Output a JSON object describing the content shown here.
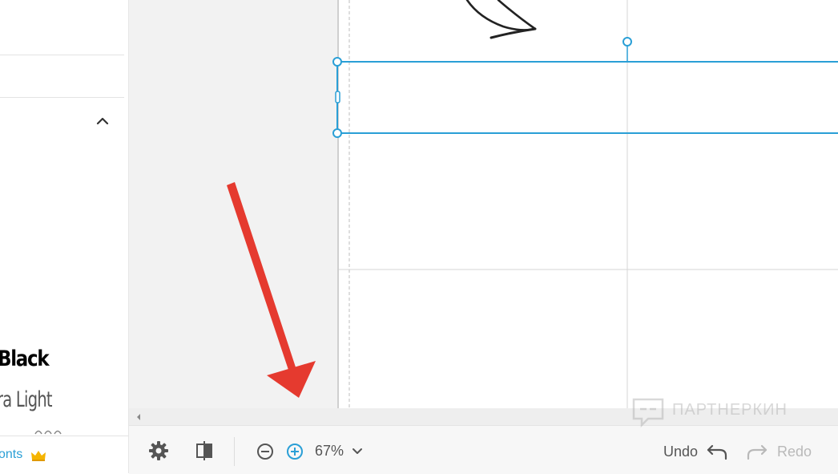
{
  "left_panel": {
    "font_samples": [
      {
        "label": "Black"
      },
      {
        "label": "ra Light"
      }
    ],
    "fonts_link": "onts",
    "crown_icon": "crown-icon",
    "collapse_icon": "chevron-up-icon"
  },
  "toolbar": {
    "settings_icon": "gear-icon",
    "layout_icon": "split-panel-icon",
    "zoom_out_icon": "zoom-out-icon",
    "zoom_in_icon": "zoom-in-icon",
    "zoom_level": "67%",
    "zoom_dropdown_icon": "chevron-down-icon",
    "undo_label": "Undo",
    "redo_label": "Redo"
  },
  "watermark": {
    "text": "ПАРТНЕРКИН"
  },
  "colors": {
    "selection": "#2a9fd6",
    "arrow": "#e53a2f",
    "link": "#2a9fd6",
    "crown": "#f5b400"
  }
}
